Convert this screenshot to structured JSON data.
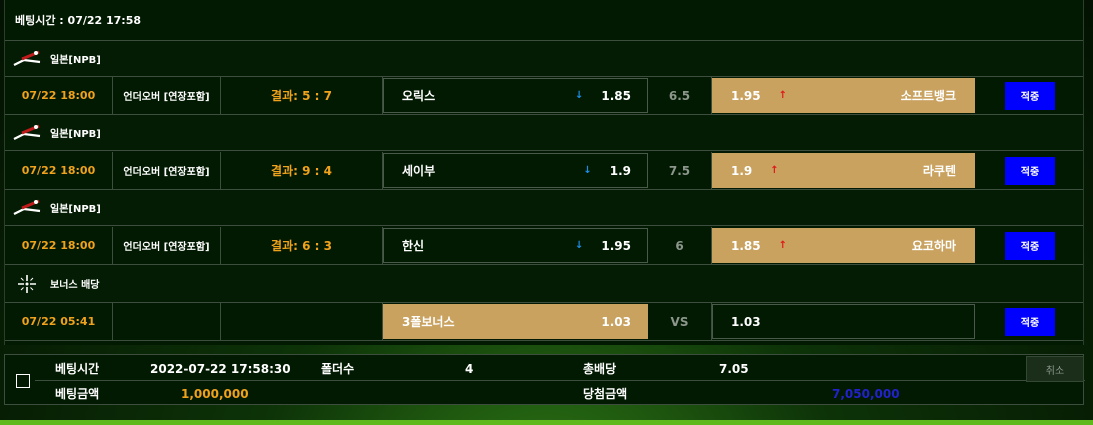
{
  "header": {
    "bet_time": "베팅시간 : 07/22 17:58"
  },
  "games": [
    {
      "league": "일본[NPB]",
      "date": "07/22 18:00",
      "type": "언더오버 [연장포함]",
      "result": "결과: 5 : 7",
      "home_team": "오릭스",
      "home_odds": "1.85",
      "home_arrow": "↓",
      "line": "6.5",
      "away_odds": "1.95",
      "away_arrow": "↑",
      "away_team": "소프트뱅크",
      "status": "적중"
    },
    {
      "league": "일본[NPB]",
      "date": "07/22 18:00",
      "type": "언더오버 [연장포함]",
      "result": "결과: 9 : 4",
      "home_team": "세이부",
      "home_odds": "1.9",
      "home_arrow": "↓",
      "line": "7.5",
      "away_odds": "1.9",
      "away_arrow": "↑",
      "away_team": "라쿠텐",
      "status": "적중"
    },
    {
      "league": "일본[NPB]",
      "date": "07/22 18:00",
      "type": "언더오버 [연장포함]",
      "result": "결과: 6 : 3",
      "home_team": "한신",
      "home_odds": "1.95",
      "home_arrow": "↓",
      "line": "6",
      "away_odds": "1.85",
      "away_arrow": "↑",
      "away_team": "요코하마",
      "status": "적중"
    }
  ],
  "bonus": {
    "league": "보너스 배당",
    "date": "07/22 05:41",
    "name": "3폴보너스",
    "odds": "1.03",
    "vs": "VS",
    "right_odds": "1.03",
    "status": "적중"
  },
  "summary": {
    "bet_time_label": "베팅시간",
    "bet_time_value": "2022-07-22 17:58:30",
    "folder_label": "폴더수",
    "folder_value": "4",
    "total_odds_label": "총배당",
    "total_odds_value": "7.05",
    "cancel_label": "취소",
    "bet_amount_label": "베팅금액",
    "bet_amount_value": "1,000,000",
    "win_amount_label": "당첨금액",
    "win_amount_value": "7,050,000"
  },
  "colors": {
    "accent_orange": "#f0a21c",
    "pick_gold": "#c9a260",
    "status_blue": "#0000ff",
    "win_amount_blue": "#2222cc",
    "arrow_up_red": "#e0191a",
    "arrow_down_blue": "#1c8ee6"
  },
  "icons": {
    "league": "baseball-japan-icon",
    "bonus": "sparkle-icon"
  }
}
